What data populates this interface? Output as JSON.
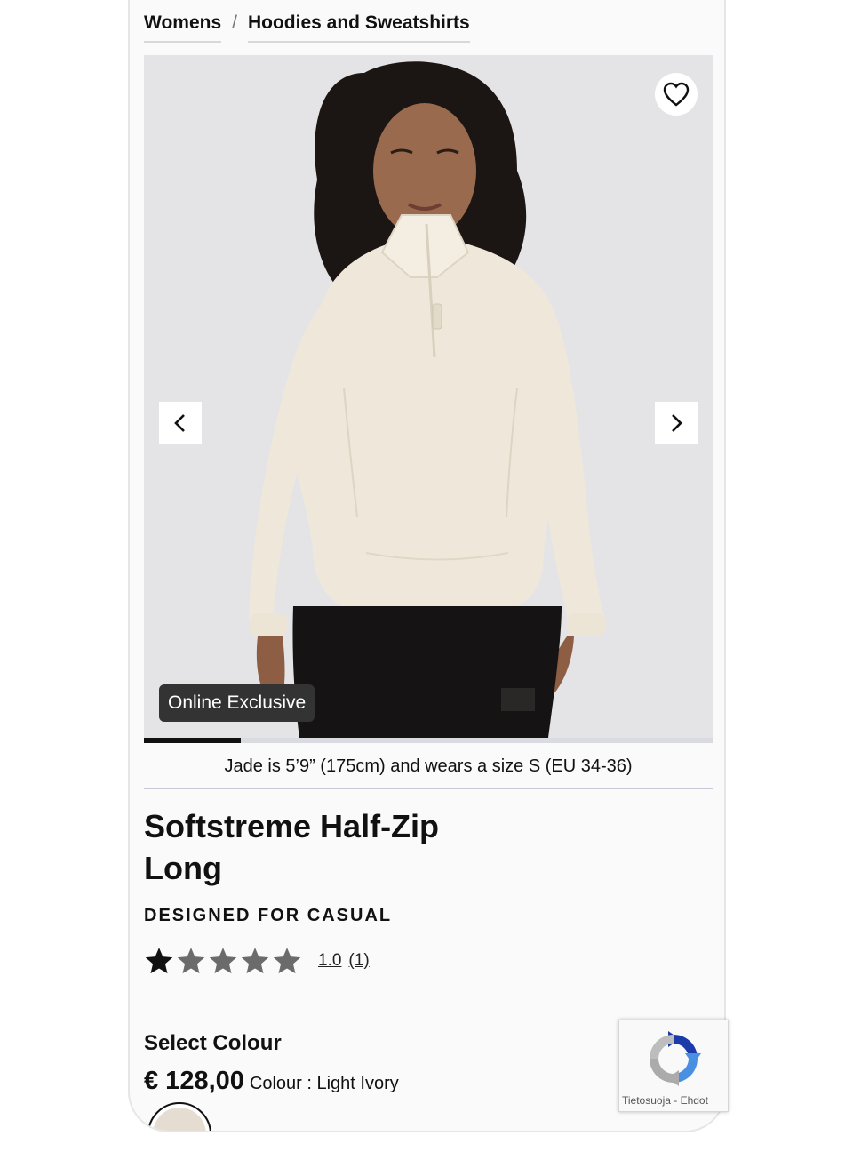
{
  "breadcrumb": {
    "items": [
      {
        "label": "Womens"
      },
      {
        "label": "Hoodies and Sweatshirts"
      }
    ],
    "separator": "/"
  },
  "gallery": {
    "badge": "Online Exclusive",
    "wishlist_icon": "heart-icon",
    "prev_icon": "chevron-left-icon",
    "next_icon": "chevron-right-icon",
    "progress": 0.17,
    "model_note": "Jade is 5’9” (175cm) and wears a size S (EU 34-36)"
  },
  "product": {
    "title_line1": "Softstreme Half-Zip",
    "title_line2": "Long",
    "subtitle": "DESIGNED FOR CASUAL",
    "rating_value": "1.0",
    "rating_count": "(1)",
    "rating_stars": 1,
    "select_colour": "Select Colour",
    "price": "€ 128,00",
    "colour_label": "Colour : Light Ivory"
  },
  "recaptcha": {
    "text": "Tietosuoja - Ehdot"
  },
  "colors": {
    "accent": "#111111",
    "garment": "#efe8da",
    "background": "#e4e4e6"
  }
}
